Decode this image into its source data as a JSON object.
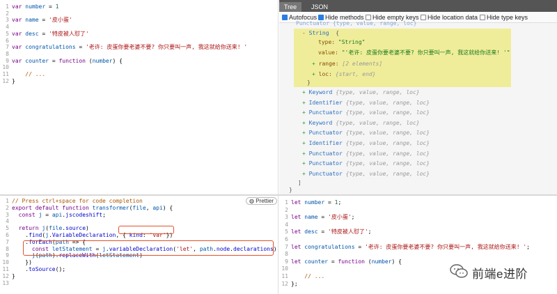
{
  "source_editor": {
    "lines": [
      {
        "n": "1",
        "html_parts": [
          [
            "kw",
            "var"
          ],
          [
            "fn",
            " "
          ],
          [
            "var",
            "number"
          ],
          [
            "fn",
            " = "
          ],
          [
            "num",
            "1"
          ]
        ]
      },
      {
        "n": "2",
        "html_parts": []
      },
      {
        "n": "3",
        "html_parts": [
          [
            "kw",
            "var"
          ],
          [
            "fn",
            " "
          ],
          [
            "var",
            "name"
          ],
          [
            "fn",
            " = "
          ],
          [
            "str",
            "'皮小蛋'"
          ]
        ]
      },
      {
        "n": "4",
        "html_parts": []
      },
      {
        "n": "5",
        "html_parts": [
          [
            "kw",
            "var"
          ],
          [
            "fn",
            " "
          ],
          [
            "var",
            "desc"
          ],
          [
            "fn",
            " = "
          ],
          [
            "str",
            "'特皮被人怼了'"
          ]
        ]
      },
      {
        "n": "6",
        "html_parts": []
      },
      {
        "n": "7",
        "html_parts": [
          [
            "kw",
            "var"
          ],
          [
            "fn",
            " "
          ],
          [
            "var",
            "congratulations"
          ],
          [
            "fn",
            " = "
          ],
          [
            "str",
            "'老许: 皮蛋你要老婆不要? 你只要叫一声, 我这就给你送来! '"
          ]
        ]
      },
      {
        "n": "8",
        "html_parts": []
      },
      {
        "n": "9",
        "html_parts": [
          [
            "kw",
            "var"
          ],
          [
            "fn",
            " "
          ],
          [
            "var",
            "counter"
          ],
          [
            "fn",
            " = "
          ],
          [
            "kw",
            "function"
          ],
          [
            "fn",
            " ("
          ],
          [
            "var",
            "number"
          ],
          [
            "fn",
            ") {"
          ]
        ]
      },
      {
        "n": "10",
        "html_parts": []
      },
      {
        "n": "11",
        "html_parts": [
          [
            "fn",
            "    "
          ],
          [
            "cm",
            "// ..."
          ]
        ]
      },
      {
        "n": "12",
        "html_parts": [
          [
            "fn",
            "}"
          ]
        ]
      }
    ]
  },
  "ast_panel": {
    "tabs": [
      "Tree",
      "JSON"
    ],
    "options": [
      {
        "label": "Autofocus",
        "checked": true
      },
      {
        "label": "Hide methods",
        "checked": true
      },
      {
        "label": "Hide empty keys",
        "checked": false
      },
      {
        "label": "Hide location data",
        "checked": false
      },
      {
        "label": "Hide type keys",
        "checked": false
      }
    ],
    "tree": {
      "top_cut": "Punctuator {type, value, range, loc}",
      "expanded_node": "String",
      "type_key": "type:",
      "type_value": "\"String\"",
      "value_key": "value:",
      "value_value": "\"'老许: 皮蛋你要老婆不要? 你只要叫一声, 我这就给你送来! '\"",
      "range_key": "range:",
      "range_hint": "[2 elements]",
      "loc_key": "loc:",
      "loc_hint": "{start, end}",
      "nodes": [
        {
          "name": "Keyword",
          "hint": "{type, value, range, loc}"
        },
        {
          "name": "Identifier",
          "hint": "{type, value, range, loc}"
        },
        {
          "name": "Punctuator",
          "hint": "{type, value, range, loc}"
        },
        {
          "name": "Keyword",
          "hint": "{type, value, range, loc}"
        },
        {
          "name": "Punctuator",
          "hint": "{type, value, range, loc}"
        },
        {
          "name": "Identifier",
          "hint": "{type, value, range, loc}"
        },
        {
          "name": "Punctuator",
          "hint": "{type, value, range, loc}"
        },
        {
          "name": "Punctuator",
          "hint": "{type, value, range, loc}"
        },
        {
          "name": "Punctuator",
          "hint": "{type, value, range, loc}"
        }
      ],
      "close_bracket": "]",
      "close_brace": "}"
    }
  },
  "transform_editor": {
    "prettier_label": "Prettier",
    "lines": [
      {
        "n": "1",
        "html_parts": [
          [
            "cm",
            "// Press ctrl+space for code completion"
          ]
        ]
      },
      {
        "n": "2",
        "html_parts": [
          [
            "kw",
            "export default function"
          ],
          [
            "fn",
            " "
          ],
          [
            "var",
            "transformer"
          ],
          [
            "fn",
            "("
          ],
          [
            "var",
            "file"
          ],
          [
            "fn",
            ", "
          ],
          [
            "var",
            "api"
          ],
          [
            "fn",
            ") {"
          ]
        ]
      },
      {
        "n": "3",
        "html_parts": [
          [
            "fn",
            "  "
          ],
          [
            "kw",
            "const"
          ],
          [
            "fn",
            " "
          ],
          [
            "var",
            "j"
          ],
          [
            "fn",
            " = "
          ],
          [
            "var",
            "api"
          ],
          [
            "fn",
            "."
          ],
          [
            "prop",
            "jscodeshift"
          ],
          [
            "fn",
            ";"
          ]
        ]
      },
      {
        "n": "4",
        "html_parts": []
      },
      {
        "n": "5",
        "html_parts": [
          [
            "fn",
            "  "
          ],
          [
            "kw",
            "return"
          ],
          [
            "fn",
            " "
          ],
          [
            "var",
            "j"
          ],
          [
            "fn",
            "("
          ],
          [
            "var",
            "file"
          ],
          [
            "fn",
            "."
          ],
          [
            "prop",
            "source"
          ],
          [
            "fn",
            ")"
          ]
        ]
      },
      {
        "n": "6",
        "html_parts": [
          [
            "fn",
            "    ."
          ],
          [
            "prop",
            "find"
          ],
          [
            "fn",
            "("
          ],
          [
            "var",
            "j"
          ],
          [
            "fn",
            "."
          ],
          [
            "prop",
            "VariableDeclaration"
          ],
          [
            "fn",
            ", { "
          ],
          [
            "prop",
            "kind"
          ],
          [
            "fn",
            ": "
          ],
          [
            "str",
            "'var'"
          ],
          [
            "fn",
            "})"
          ]
        ]
      },
      {
        "n": "7",
        "html_parts": [
          [
            "fn",
            "    ."
          ],
          [
            "prop",
            "forEach"
          ],
          [
            "fn",
            "("
          ],
          [
            "var",
            "path"
          ],
          [
            "fn",
            " => {"
          ]
        ]
      },
      {
        "n": "8",
        "html_parts": [
          [
            "fn",
            "      "
          ],
          [
            "kw",
            "const"
          ],
          [
            "fn",
            " "
          ],
          [
            "var",
            "letStatement"
          ],
          [
            "fn",
            " = "
          ],
          [
            "var",
            "j"
          ],
          [
            "fn",
            "."
          ],
          [
            "prop",
            "variableDeclaration"
          ],
          [
            "fn",
            "("
          ],
          [
            "str",
            "'let'"
          ],
          [
            "fn",
            ", "
          ],
          [
            "var",
            "path"
          ],
          [
            "fn",
            "."
          ],
          [
            "prop",
            "node"
          ],
          [
            "fn",
            "."
          ],
          [
            "prop",
            "declarations"
          ],
          [
            "fn",
            ")"
          ]
        ]
      },
      {
        "n": "9",
        "html_parts": [
          [
            "fn",
            "      "
          ],
          [
            "var",
            "j"
          ],
          [
            "fn",
            "("
          ],
          [
            "var",
            "path"
          ],
          [
            "fn",
            ")."
          ],
          [
            "prop",
            "replaceWith"
          ],
          [
            "fn",
            "("
          ],
          [
            "var",
            "letStatement"
          ],
          [
            "fn",
            ")"
          ]
        ]
      },
      {
        "n": "10",
        "html_parts": [
          [
            "fn",
            "    })"
          ]
        ]
      },
      {
        "n": "11",
        "html_parts": [
          [
            "fn",
            "    ."
          ],
          [
            "prop",
            "toSource"
          ],
          [
            "fn",
            "();"
          ]
        ]
      },
      {
        "n": "12",
        "html_parts": [
          [
            "fn",
            "}"
          ]
        ]
      },
      {
        "n": "13",
        "html_parts": []
      }
    ]
  },
  "output_editor": {
    "lines": [
      {
        "n": "1",
        "html_parts": [
          [
            "kw",
            "let"
          ],
          [
            "fn",
            " "
          ],
          [
            "var",
            "number"
          ],
          [
            "fn",
            " = "
          ],
          [
            "num",
            "1"
          ],
          [
            "fn",
            ";"
          ]
        ]
      },
      {
        "n": "2",
        "html_parts": []
      },
      {
        "n": "3",
        "html_parts": [
          [
            "kw",
            "let"
          ],
          [
            "fn",
            " "
          ],
          [
            "var",
            "name"
          ],
          [
            "fn",
            " = "
          ],
          [
            "str",
            "'皮小蛋'"
          ],
          [
            "fn",
            ";"
          ]
        ]
      },
      {
        "n": "4",
        "html_parts": []
      },
      {
        "n": "5",
        "html_parts": [
          [
            "kw",
            "let"
          ],
          [
            "fn",
            " "
          ],
          [
            "var",
            "desc"
          ],
          [
            "fn",
            " = "
          ],
          [
            "str",
            "'特皮被人怼了'"
          ],
          [
            "fn",
            ";"
          ]
        ]
      },
      {
        "n": "6",
        "html_parts": []
      },
      {
        "n": "7",
        "html_parts": [
          [
            "kw",
            "let"
          ],
          [
            "fn",
            " "
          ],
          [
            "var",
            "congratulations"
          ],
          [
            "fn",
            " = "
          ],
          [
            "str",
            "'老许: 皮蛋你要老婆不要? 你只要叫一声, 我这就给你送来! '"
          ],
          [
            "fn",
            ";"
          ]
        ]
      },
      {
        "n": "8",
        "html_parts": []
      },
      {
        "n": "9",
        "html_parts": [
          [
            "kw",
            "let"
          ],
          [
            "fn",
            " "
          ],
          [
            "var",
            "counter"
          ],
          [
            "fn",
            " = "
          ],
          [
            "kw",
            "function"
          ],
          [
            "fn",
            " ("
          ],
          [
            "var",
            "number"
          ],
          [
            "fn",
            ") {"
          ]
        ]
      },
      {
        "n": "10",
        "html_parts": []
      },
      {
        "n": "11",
        "html_parts": [
          [
            "fn",
            "    "
          ],
          [
            "cm",
            "// ..."
          ]
        ]
      },
      {
        "n": "12",
        "html_parts": [
          [
            "fn",
            "};"
          ]
        ]
      }
    ]
  },
  "watermark": {
    "text": "前端e进阶"
  }
}
